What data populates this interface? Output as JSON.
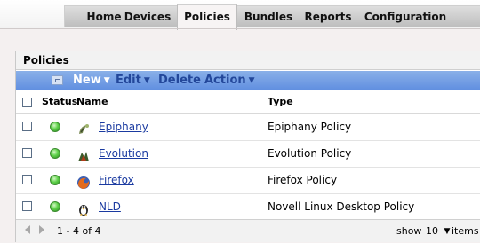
{
  "nav": {
    "tabs": [
      {
        "label": "Home",
        "active": false
      },
      {
        "label": "Devices",
        "active": false
      },
      {
        "label": "Policies",
        "active": true
      },
      {
        "label": "Bundles",
        "active": false
      },
      {
        "label": "Reports",
        "active": false
      },
      {
        "label": "Configuration",
        "active": false
      }
    ]
  },
  "panel": {
    "title": "Policies",
    "toolbar": {
      "new_label": "New",
      "edit_label": "Edit",
      "delete_label": "Delete",
      "action_label": "Action"
    },
    "columns": {
      "status": "Status",
      "name": "Name",
      "type": "Type"
    },
    "rows": [
      {
        "name": "Epiphany",
        "type": "Epiphany Policy",
        "icon": "epiphany-icon",
        "status": "green"
      },
      {
        "name": "Evolution",
        "type": "Evolution Policy",
        "icon": "evolution-icon",
        "status": "green"
      },
      {
        "name": "Firefox",
        "type": "Firefox Policy",
        "icon": "firefox-icon",
        "status": "green"
      },
      {
        "name": "NLD",
        "type": "Novell Linux Desktop Policy",
        "icon": "nld-icon",
        "status": "green"
      }
    ],
    "footer": {
      "range": "1 - 4 of 4",
      "show_label": "show",
      "page_size": "10",
      "items_label": "items"
    }
  },
  "colors": {
    "toolbar_blue": "#6f9de6",
    "link_blue": "#1a3aa0",
    "status_green": "#5fd14a"
  }
}
